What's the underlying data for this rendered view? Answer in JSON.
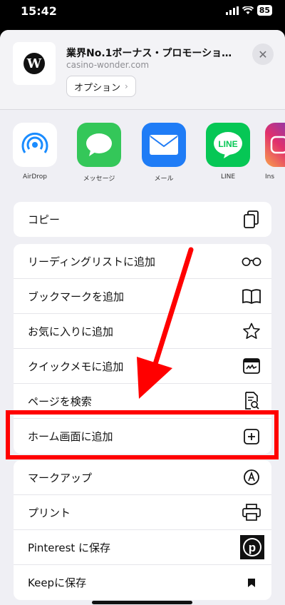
{
  "status": {
    "time": "15:42",
    "battery": "85"
  },
  "header": {
    "title": "業界No.1ボーナス・プロモーショ…",
    "subtitle": "casino-wonder.com",
    "options_label": "オプション",
    "logo_letter": "W"
  },
  "apps": [
    {
      "label": "AirDrop",
      "icon": "airdrop-icon",
      "color": "#ffffff"
    },
    {
      "label": "メッセージ",
      "icon": "messages-icon",
      "color": "#34c759"
    },
    {
      "label": "メール",
      "icon": "mail-icon",
      "color": "#1f7cf6"
    },
    {
      "label": "LINE",
      "icon": "line-icon",
      "color": "#06c755"
    },
    {
      "label": "Ins",
      "icon": "instagram-icon",
      "color": "#c13584"
    }
  ],
  "actions": {
    "group1": [
      {
        "label": "コピー",
        "icon": "copy-icon"
      }
    ],
    "group2": [
      {
        "label": "リーディングリストに追加",
        "icon": "glasses-icon"
      },
      {
        "label": "ブックマークを追加",
        "icon": "book-icon"
      },
      {
        "label": "お気に入りに追加",
        "icon": "star-icon"
      },
      {
        "label": "クイックメモに追加",
        "icon": "quick-note-icon"
      },
      {
        "label": "ページを検索",
        "icon": "find-page-icon"
      },
      {
        "label": "ホーム画面に追加",
        "icon": "add-square-icon"
      }
    ],
    "group3": [
      {
        "label": "マークアップ",
        "icon": "markup-icon"
      },
      {
        "label": "プリント",
        "icon": "printer-icon"
      },
      {
        "label": "Pinterest に保存",
        "icon": "pinterest-icon"
      },
      {
        "label": "Keepに保存",
        "icon": "keep-bookmark-icon"
      }
    ]
  },
  "annotation_color": "#ff0000"
}
